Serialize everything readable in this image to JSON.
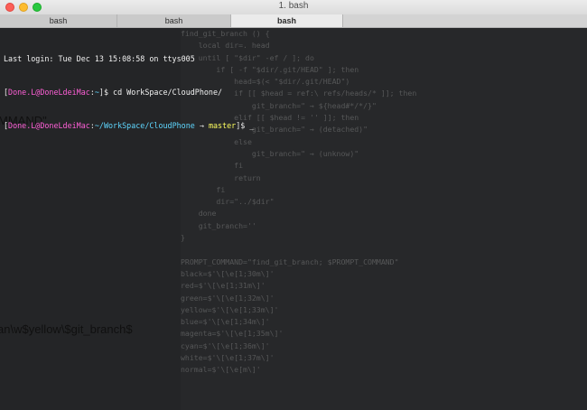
{
  "window": {
    "title": "1. bash"
  },
  "tabs": [
    {
      "label": "bash",
      "active": false
    },
    {
      "label": "bash",
      "active": false
    },
    {
      "label": "bash",
      "active": true
    }
  ],
  "terminal": {
    "last_login": "Last login: Tue Dec 13 15:08:58 on ttys005",
    "prompt1": {
      "open": "[",
      "user_host": "Done.L@DoneLdeiMac",
      "sep": ":",
      "path": "~",
      "close": "]$ ",
      "command": "cd WorkSpace/CloudPhone/"
    },
    "prompt2": {
      "open": "[",
      "user_host": "Done.L@DoneLdeiMac",
      "sep": ":",
      "path": "~/WorkSpace/CloudPhone",
      "arrow": " → ",
      "branch": "master",
      "close": "]$ ",
      "input": "_"
    }
  },
  "background_editor": {
    "lines": [
      "find_git_branch () {",
      "    local dir=. head",
      "    until [ \"$dir\" -ef / ]; do",
      "        if [ -f \"$dir/.git/HEAD\" ]; then",
      "            head=$(< \"$dir/.git/HEAD\")",
      "            if [[ $head = ref:\\ refs/heads/* ]]; then",
      "                git_branch=\" → ${head#*/*/}\"",
      "            elif [[ $head != '' ]]; then",
      "                git_branch=\" → (detached)\"",
      "            else",
      "                git_branch=\" → (unknow)\"",
      "            fi",
      "            return",
      "        fi",
      "        dir=\"../$dir\"",
      "    done",
      "    git_branch=''",
      "}",
      "",
      "PROMPT_COMMAND=\"find_git_branch; $PROMPT_COMMAND\"",
      "black=$'\\[\\e[1;30m\\]'",
      "red=$'\\[\\e[1;31m\\]'",
      "green=$'\\[\\e[1;32m\\]'",
      "yellow=$'\\[\\e[1;33m\\]'",
      "blue=$'\\[\\e[1;34m\\]'",
      "magenta=$'\\[\\e[1;35m\\]'",
      "cyan=$'\\[\\e[1;36m\\]'",
      "white=$'\\[\\e[1;37m\\]'",
      "normal=$'\\[\\e[m\\]'"
    ],
    "ghost_text_1": "MMAND\"",
    "ghost_text_2": "an\\w$yellow\\$git_branch$"
  },
  "colors": {
    "user_host": "#ff5fd7",
    "path": "#5fd7ff",
    "branch": "#ffff5f",
    "background": "#1c1d1f"
  }
}
